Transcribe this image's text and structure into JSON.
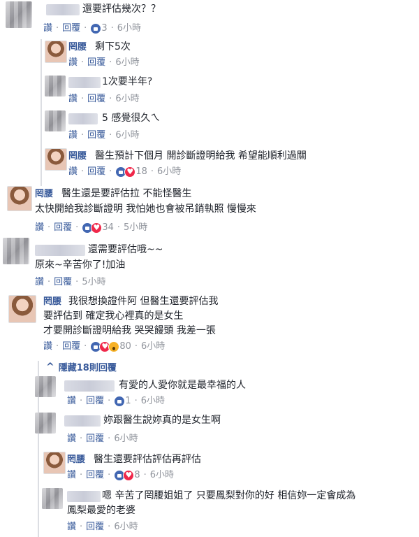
{
  "actions": {
    "like": "讚",
    "reply": "回覆",
    "dot": "·"
  },
  "comments": [
    {
      "text": "還要評估幾次？？",
      "reactions": [
        "like"
      ],
      "count": "3",
      "time": "6小時"
    },
    {
      "author": "罔腰",
      "text": "剩下5次",
      "time": "6小時"
    },
    {
      "text": "1次要半年?",
      "time": "6小時"
    },
    {
      "text": "5 感覺很久ㄟ",
      "time": "6小時"
    },
    {
      "author": "罔腰",
      "text": "醫生預計下個月 開診斷證明給我 希望能順利過關",
      "reactions": [
        "like",
        "heart"
      ],
      "count": "18",
      "time": "6小時"
    },
    {
      "author": "罔腰",
      "text_lines": [
        "醫生還是要評估拉 不能怪醫生",
        "太快開給我診斷證明 我怕她也會被吊銷執照 慢慢來"
      ],
      "reactions": [
        "like",
        "heart"
      ],
      "count": "34",
      "time": "5小時"
    },
    {
      "text_lines": [
        "還需要評估哦~~",
        "原來~辛苦你了!加油"
      ],
      "time": "5小時"
    },
    {
      "author": "罔腰",
      "text_lines": [
        "我很想換證件阿 但醫生還要評估我",
        "要評估到 確定我心裡真的是女生",
        "才要開診斷證明給我 哭哭饅頭 我差一張"
      ],
      "reactions": [
        "like",
        "heart",
        "wow"
      ],
      "count": "80",
      "time": "6小時"
    },
    {
      "text": "有愛的人愛你就是最幸福的人",
      "reactions": [
        "like"
      ],
      "count": "1",
      "time": "6小時"
    },
    {
      "text": "妳跟醫生說妳真的是女生啊",
      "time": "6小時"
    },
    {
      "author": "罔腰",
      "text": "醫生還要評估評估再評估",
      "reactions": [
        "like",
        "heart"
      ],
      "count": "8",
      "time": "6小時"
    },
    {
      "text_lines": [
        "嗯 辛苦了罔腰姐姐了 只要鳳梨對你的好 相信妳一定會成為",
        "鳳梨最愛的老婆"
      ],
      "time": "6小時"
    }
  ],
  "hide_replies": {
    "arrow": "^",
    "label": "隱藏18則回覆"
  }
}
